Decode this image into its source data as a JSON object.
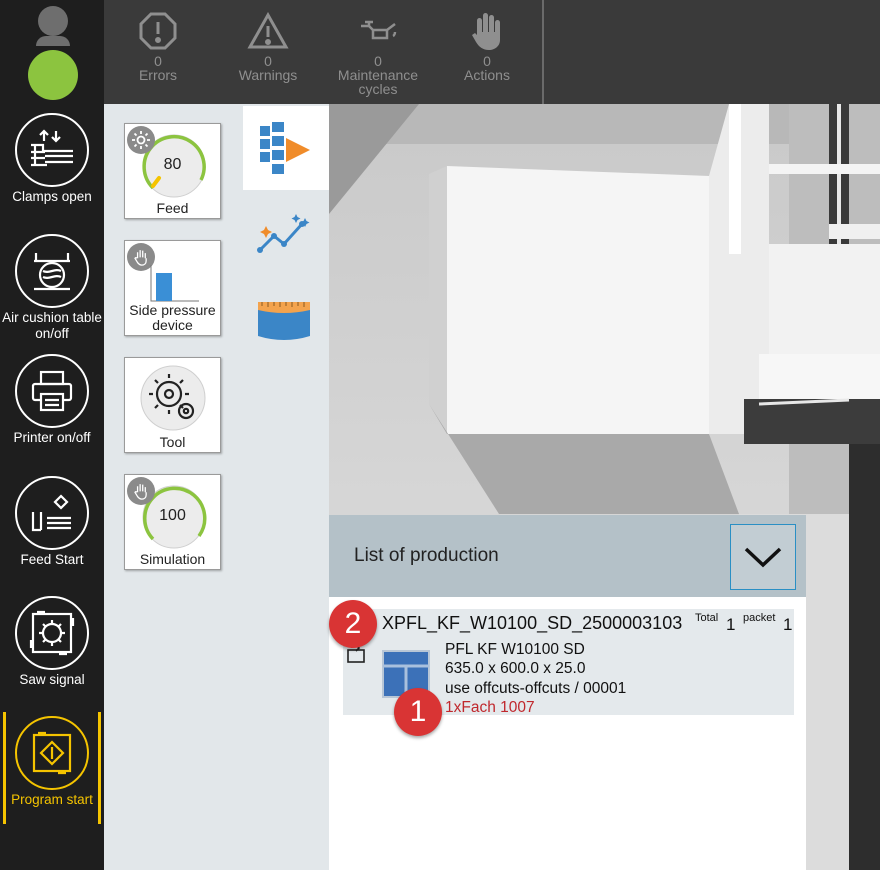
{
  "status_bar": [
    {
      "count": "0",
      "label": "Errors",
      "icon": "error-icon"
    },
    {
      "count": "0",
      "label": "Warnings",
      "icon": "warning-icon"
    },
    {
      "count": "0",
      "label": "Maintenance cycles",
      "icon": "oil-can-icon"
    },
    {
      "count": "0",
      "label": "Actions",
      "icon": "hand-icon"
    }
  ],
  "sidebar": {
    "user_status_color": "#8cc43f",
    "buttons": [
      {
        "label": "Clamps open",
        "icon": "clamps-icon"
      },
      {
        "label": "Air cushion table on/off",
        "icon": "air-cushion-table-icon"
      },
      {
        "label": "Printer on/off",
        "icon": "printer-icon"
      },
      {
        "label": "Feed Start",
        "icon": "feed-start-icon"
      },
      {
        "label": "Saw signal",
        "icon": "saw-signal-icon"
      },
      {
        "label": "Program start",
        "icon": "program-start-icon",
        "active": true
      }
    ]
  },
  "tools": {
    "feed": {
      "label": "Feed",
      "value": "80",
      "icon": "gear-icon"
    },
    "side_pressure": {
      "label": "Side pressure device",
      "icon": "hand-icon"
    },
    "tool": {
      "label": "Tool",
      "icon": "saw-blade-icon"
    },
    "simulation": {
      "label": "Simulation",
      "value": "100",
      "icon": "hand-icon"
    }
  },
  "tabs": [
    {
      "icon": "production-tab-icon",
      "active": true
    },
    {
      "icon": "analytics-tab-icon"
    },
    {
      "icon": "panel-tab-icon"
    }
  ],
  "production_list": {
    "title": "List of production",
    "item": {
      "code": "XPFL_KF_W10100_SD_2500003103",
      "total_label": "Total",
      "total": "1",
      "packet_label": "packet",
      "packet": "1",
      "material": "PFL KF W10100 SD",
      "dimensions": "635.0 x 600.0 x 25.0",
      "source": "use  offcuts-offcuts / 00001",
      "storage": "1xFach 1007"
    }
  },
  "markers": [
    "1",
    "2"
  ],
  "colors": {
    "accent_yellow": "#f5c400",
    "marker_red": "#d93434",
    "storage_red": "#c0282d"
  }
}
